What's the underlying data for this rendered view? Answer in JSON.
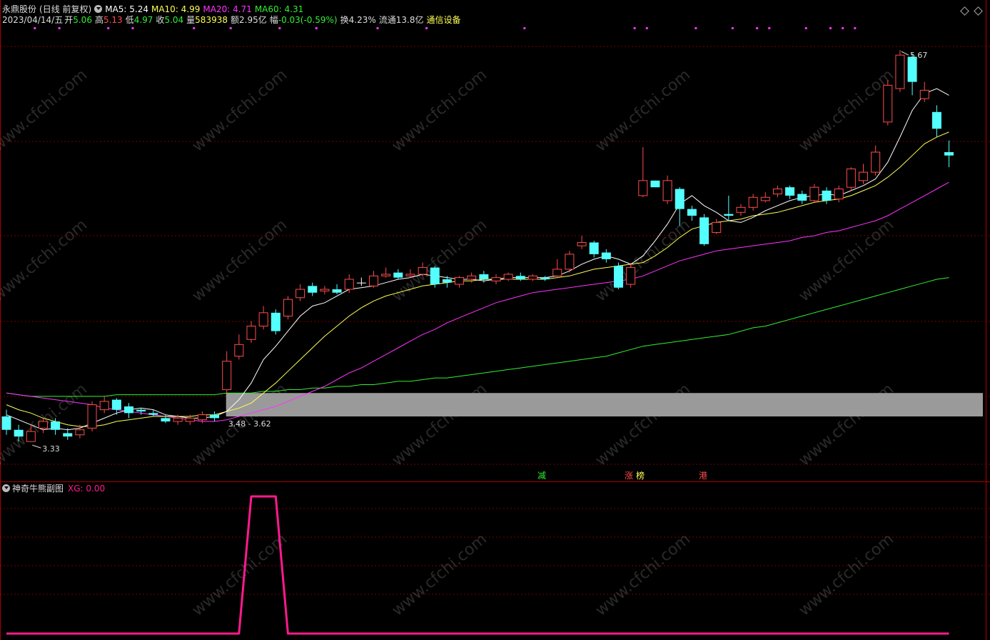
{
  "header": {
    "stock_name": "永鼎股份",
    "period": "(日线 前复权)",
    "ma5": "MA5: 5.24",
    "ma10": "MA10: 4.99",
    "ma20": "MA20: 4.71",
    "ma60": "MA60: 4.31",
    "date": "2023/04/14/五",
    "open_label": "开",
    "open": "5.06",
    "high_label": "高",
    "high": "5.13",
    "low_label": "低",
    "low": "4.97",
    "close_label": "收",
    "close": "5.04",
    "volume_label": "量",
    "volume": "583938",
    "amount_label": "额",
    "amount": "2.95亿",
    "change_label": "幅",
    "change": "-0.03(-0.59%)",
    "turnover_label": "换",
    "turnover": "4.23%",
    "float_label": "流通",
    "float": "13.8亿",
    "sector": "通信设备"
  },
  "colors": {
    "up": "#ff4c4c",
    "down": "#54ffff",
    "ma5": "#ffffff",
    "ma10": "#ffff55",
    "ma20": "#ff33ff",
    "ma60": "#33ee33",
    "grid": "#7a0000",
    "zone": "#9a9a9a",
    "xg": "#ff1a8c",
    "wm": "#ffffff"
  },
  "annotations": {
    "high_label": "5.67",
    "low_label": "3.33",
    "zone_label": "3.48 - 3.62"
  },
  "event_tags": [
    {
      "text": "减",
      "color": "#33ee33"
    },
    {
      "text": "涨",
      "color": "#ff4c4c"
    },
    {
      "text": "榜",
      "color": "#ffff55"
    },
    {
      "text": "港",
      "color": "#ff4c4c"
    }
  ],
  "sub_panel": {
    "title": "神奇牛熊副图",
    "xg_label": "XG: 0.00"
  },
  "watermark": "www.cfchi.com",
  "chart_data": [
    {
      "type": "candlestick",
      "title": "永鼎股份 (日线 前复权)",
      "ylim": [
        3.1,
        5.85
      ],
      "zone": [
        3.48,
        3.62
      ],
      "candles": [
        [
          3.48,
          3.4,
          3.52,
          3.37
        ],
        [
          3.4,
          3.36,
          3.43,
          3.33
        ],
        [
          3.33,
          3.39,
          3.43,
          3.33
        ],
        [
          3.41,
          3.45,
          3.47,
          3.38
        ],
        [
          3.45,
          3.4,
          3.47,
          3.37
        ],
        [
          3.38,
          3.36,
          3.41,
          3.34
        ],
        [
          3.37,
          3.4,
          3.43,
          3.35
        ],
        [
          3.41,
          3.55,
          3.57,
          3.39
        ],
        [
          3.52,
          3.57,
          3.6,
          3.5
        ],
        [
          3.58,
          3.52,
          3.59,
          3.49
        ],
        [
          3.54,
          3.5,
          3.56,
          3.47
        ],
        [
          3.52,
          3.51,
          3.53,
          3.49
        ],
        [
          3.5,
          3.49,
          3.52,
          3.48
        ],
        [
          3.47,
          3.45,
          3.49,
          3.44
        ],
        [
          3.45,
          3.47,
          3.49,
          3.43
        ],
        [
          3.45,
          3.47,
          3.49,
          3.43
        ],
        [
          3.46,
          3.49,
          3.51,
          3.44
        ],
        [
          3.49,
          3.47,
          3.51,
          3.45
        ],
        [
          3.64,
          3.81,
          3.87,
          3.62
        ],
        [
          3.84,
          3.91,
          3.97,
          3.82
        ],
        [
          3.94,
          4.02,
          4.05,
          3.92
        ],
        [
          4.02,
          4.1,
          4.14,
          4.0
        ],
        [
          4.1,
          3.99,
          4.12,
          3.97
        ],
        [
          4.08,
          4.18,
          4.2,
          4.06
        ],
        [
          4.19,
          4.24,
          4.27,
          4.17
        ],
        [
          4.26,
          4.22,
          4.28,
          4.2
        ],
        [
          4.23,
          4.24,
          4.26,
          4.21
        ],
        [
          4.24,
          4.22,
          4.27,
          4.21
        ],
        [
          4.24,
          4.3,
          4.33,
          4.22
        ],
        [
          4.28,
          4.28,
          4.31,
          4.26
        ],
        [
          4.26,
          4.32,
          4.35,
          4.25
        ],
        [
          4.32,
          4.33,
          4.37,
          4.31
        ],
        [
          4.34,
          4.31,
          4.36,
          4.3
        ],
        [
          4.32,
          4.33,
          4.36,
          4.31
        ],
        [
          4.33,
          4.37,
          4.4,
          4.32
        ],
        [
          4.37,
          4.27,
          4.38,
          4.25
        ],
        [
          4.3,
          4.28,
          4.32,
          4.25
        ],
        [
          4.27,
          4.31,
          4.32,
          4.25
        ],
        [
          4.3,
          4.32,
          4.34,
          4.28
        ],
        [
          4.33,
          4.3,
          4.35,
          4.28
        ],
        [
          4.29,
          4.31,
          4.33,
          4.27
        ],
        [
          4.3,
          4.33,
          4.34,
          4.29
        ],
        [
          4.32,
          4.3,
          4.34,
          4.29
        ],
        [
          4.3,
          4.32,
          4.33,
          4.29
        ],
        [
          4.31,
          4.3,
          4.32,
          4.29
        ],
        [
          4.32,
          4.36,
          4.42,
          4.31
        ],
        [
          4.36,
          4.45,
          4.47,
          4.34
        ],
        [
          4.5,
          4.52,
          4.56,
          4.48
        ],
        [
          4.52,
          4.45,
          4.53,
          4.43
        ],
        [
          4.46,
          4.42,
          4.48,
          4.4
        ],
        [
          4.38,
          4.25,
          4.4,
          4.24
        ],
        [
          4.27,
          4.37,
          4.39,
          4.25
        ],
        [
          4.8,
          4.89,
          5.09,
          4.79
        ],
        [
          4.89,
          4.85,
          4.89,
          4.85
        ],
        [
          4.77,
          4.89,
          4.92,
          4.75
        ],
        [
          4.84,
          4.72,
          4.85,
          4.62
        ],
        [
          4.72,
          4.68,
          4.74,
          4.65
        ],
        [
          4.67,
          4.51,
          4.69,
          4.5
        ],
        [
          4.58,
          4.64,
          4.66,
          4.57
        ],
        [
          4.69,
          4.68,
          4.8,
          4.65
        ],
        [
          4.7,
          4.73,
          4.75,
          4.68
        ],
        [
          4.73,
          4.79,
          4.81,
          4.71
        ],
        [
          4.77,
          4.79,
          4.82,
          4.76
        ],
        [
          4.81,
          4.84,
          4.86,
          4.79
        ],
        [
          4.85,
          4.8,
          4.86,
          4.78
        ],
        [
          4.81,
          4.77,
          4.83,
          4.75
        ],
        [
          4.77,
          4.85,
          4.87,
          4.76
        ],
        [
          4.83,
          4.77,
          4.85,
          4.75
        ],
        [
          4.78,
          4.84,
          4.86,
          4.76
        ],
        [
          4.85,
          4.96,
          4.97,
          4.83
        ],
        [
          4.89,
          4.94,
          4.99,
          4.87
        ],
        [
          4.94,
          5.06,
          5.1,
          4.92
        ],
        [
          5.24,
          5.46,
          5.49,
          5.22
        ],
        [
          5.44,
          5.64,
          5.67,
          5.42
        ],
        [
          5.63,
          5.48,
          5.65,
          5.4
        ],
        [
          5.38,
          5.43,
          5.48,
          5.36
        ],
        [
          5.3,
          5.2,
          5.34,
          5.15
        ],
        [
          5.06,
          5.04,
          5.13,
          4.97
        ]
      ],
      "ma5": [
        3.49,
        3.46,
        3.43,
        3.4,
        3.41,
        3.4,
        3.41,
        3.44,
        3.47,
        3.5,
        3.52,
        3.53,
        3.52,
        3.49,
        3.48,
        3.47,
        3.47,
        3.48,
        3.51,
        3.58,
        3.68,
        3.82,
        3.9,
        3.99,
        4.08,
        4.14,
        4.16,
        4.2,
        4.24,
        4.25,
        4.26,
        4.28,
        4.3,
        4.31,
        4.33,
        4.32,
        4.31,
        4.3,
        4.3,
        4.29,
        4.3,
        4.31,
        4.31,
        4.31,
        4.31,
        4.32,
        4.35,
        4.39,
        4.42,
        4.44,
        4.42,
        4.39,
        4.44,
        4.53,
        4.63,
        4.75,
        4.8,
        4.74,
        4.7,
        4.65,
        4.64,
        4.67,
        4.71,
        4.74,
        4.77,
        4.79,
        4.8,
        4.81,
        4.8,
        4.83,
        4.86,
        4.9,
        5.0,
        5.15,
        5.31,
        5.41,
        5.44,
        5.4
      ],
      "ma10": [
        3.55,
        3.52,
        3.5,
        3.47,
        3.45,
        3.43,
        3.42,
        3.42,
        3.43,
        3.45,
        3.46,
        3.47,
        3.48,
        3.48,
        3.48,
        3.48,
        3.49,
        3.49,
        3.51,
        3.53,
        3.56,
        3.62,
        3.68,
        3.75,
        3.82,
        3.89,
        3.96,
        4.02,
        4.08,
        4.13,
        4.17,
        4.2,
        4.22,
        4.24,
        4.26,
        4.27,
        4.28,
        4.29,
        4.29,
        4.3,
        4.3,
        4.3,
        4.3,
        4.3,
        4.3,
        4.31,
        4.32,
        4.34,
        4.36,
        4.37,
        4.38,
        4.39,
        4.4,
        4.44,
        4.49,
        4.55,
        4.6,
        4.62,
        4.64,
        4.65,
        4.66,
        4.68,
        4.69,
        4.7,
        4.72,
        4.74,
        4.76,
        4.77,
        4.78,
        4.8,
        4.83,
        4.86,
        4.91,
        4.97,
        5.04,
        5.11,
        5.15,
        5.18
      ],
      "ma20": [
        3.62,
        3.61,
        3.6,
        3.59,
        3.58,
        3.57,
        3.56,
        3.55,
        3.53,
        3.52,
        3.51,
        3.5,
        3.49,
        3.48,
        3.47,
        3.46,
        3.45,
        3.45,
        3.46,
        3.48,
        3.5,
        3.52,
        3.54,
        3.57,
        3.6,
        3.63,
        3.66,
        3.7,
        3.74,
        3.77,
        3.81,
        3.85,
        3.89,
        3.93,
        3.97,
        4.0,
        4.04,
        4.07,
        4.1,
        4.13,
        4.16,
        4.18,
        4.2,
        4.22,
        4.23,
        4.24,
        4.25,
        4.26,
        4.27,
        4.28,
        4.29,
        4.3,
        4.32,
        4.35,
        4.38,
        4.41,
        4.43,
        4.45,
        4.47,
        4.48,
        4.49,
        4.5,
        4.51,
        4.52,
        4.53,
        4.55,
        4.56,
        4.58,
        4.59,
        4.61,
        4.63,
        4.65,
        4.68,
        4.72,
        4.76,
        4.8,
        4.84,
        4.88
      ],
      "ma60": [
        3.62,
        3.61,
        3.6,
        3.6,
        3.6,
        3.6,
        3.6,
        3.6,
        3.6,
        3.61,
        3.61,
        3.61,
        3.61,
        3.61,
        3.61,
        3.61,
        3.61,
        3.61,
        3.62,
        3.62,
        3.62,
        3.63,
        3.63,
        3.64,
        3.64,
        3.65,
        3.65,
        3.66,
        3.66,
        3.67,
        3.67,
        3.68,
        3.69,
        3.69,
        3.7,
        3.71,
        3.71,
        3.72,
        3.73,
        3.74,
        3.75,
        3.76,
        3.77,
        3.78,
        3.79,
        3.8,
        3.81,
        3.82,
        3.83,
        3.84,
        3.86,
        3.88,
        3.9,
        3.91,
        3.92,
        3.93,
        3.94,
        3.95,
        3.96,
        3.97,
        3.99,
        4.01,
        4.02,
        4.04,
        4.06,
        4.08,
        4.1,
        4.12,
        4.14,
        4.16,
        4.18,
        4.2,
        4.22,
        4.24,
        4.26,
        4.28,
        4.3,
        4.31
      ]
    },
    {
      "type": "line",
      "series": [
        {
          "name": "XG",
          "values": [
            0,
            0,
            0,
            0,
            0,
            0,
            0,
            0,
            0,
            0,
            0,
            0,
            0,
            0,
            0,
            0,
            0,
            0,
            0,
            0,
            1,
            1,
            1,
            0,
            0,
            0,
            0,
            0,
            0,
            0,
            0,
            0,
            0,
            0,
            0,
            0,
            0,
            0,
            0,
            0,
            0,
            0,
            0,
            0,
            0,
            0,
            0,
            0,
            0,
            0,
            0,
            0,
            0,
            0,
            0,
            0,
            0,
            0,
            0,
            0,
            0,
            0,
            0,
            0,
            0,
            0,
            0,
            0,
            0,
            0,
            0,
            0,
            0,
            0,
            0,
            0,
            0,
            0
          ]
        }
      ],
      "ylim": [
        0,
        1
      ]
    }
  ]
}
